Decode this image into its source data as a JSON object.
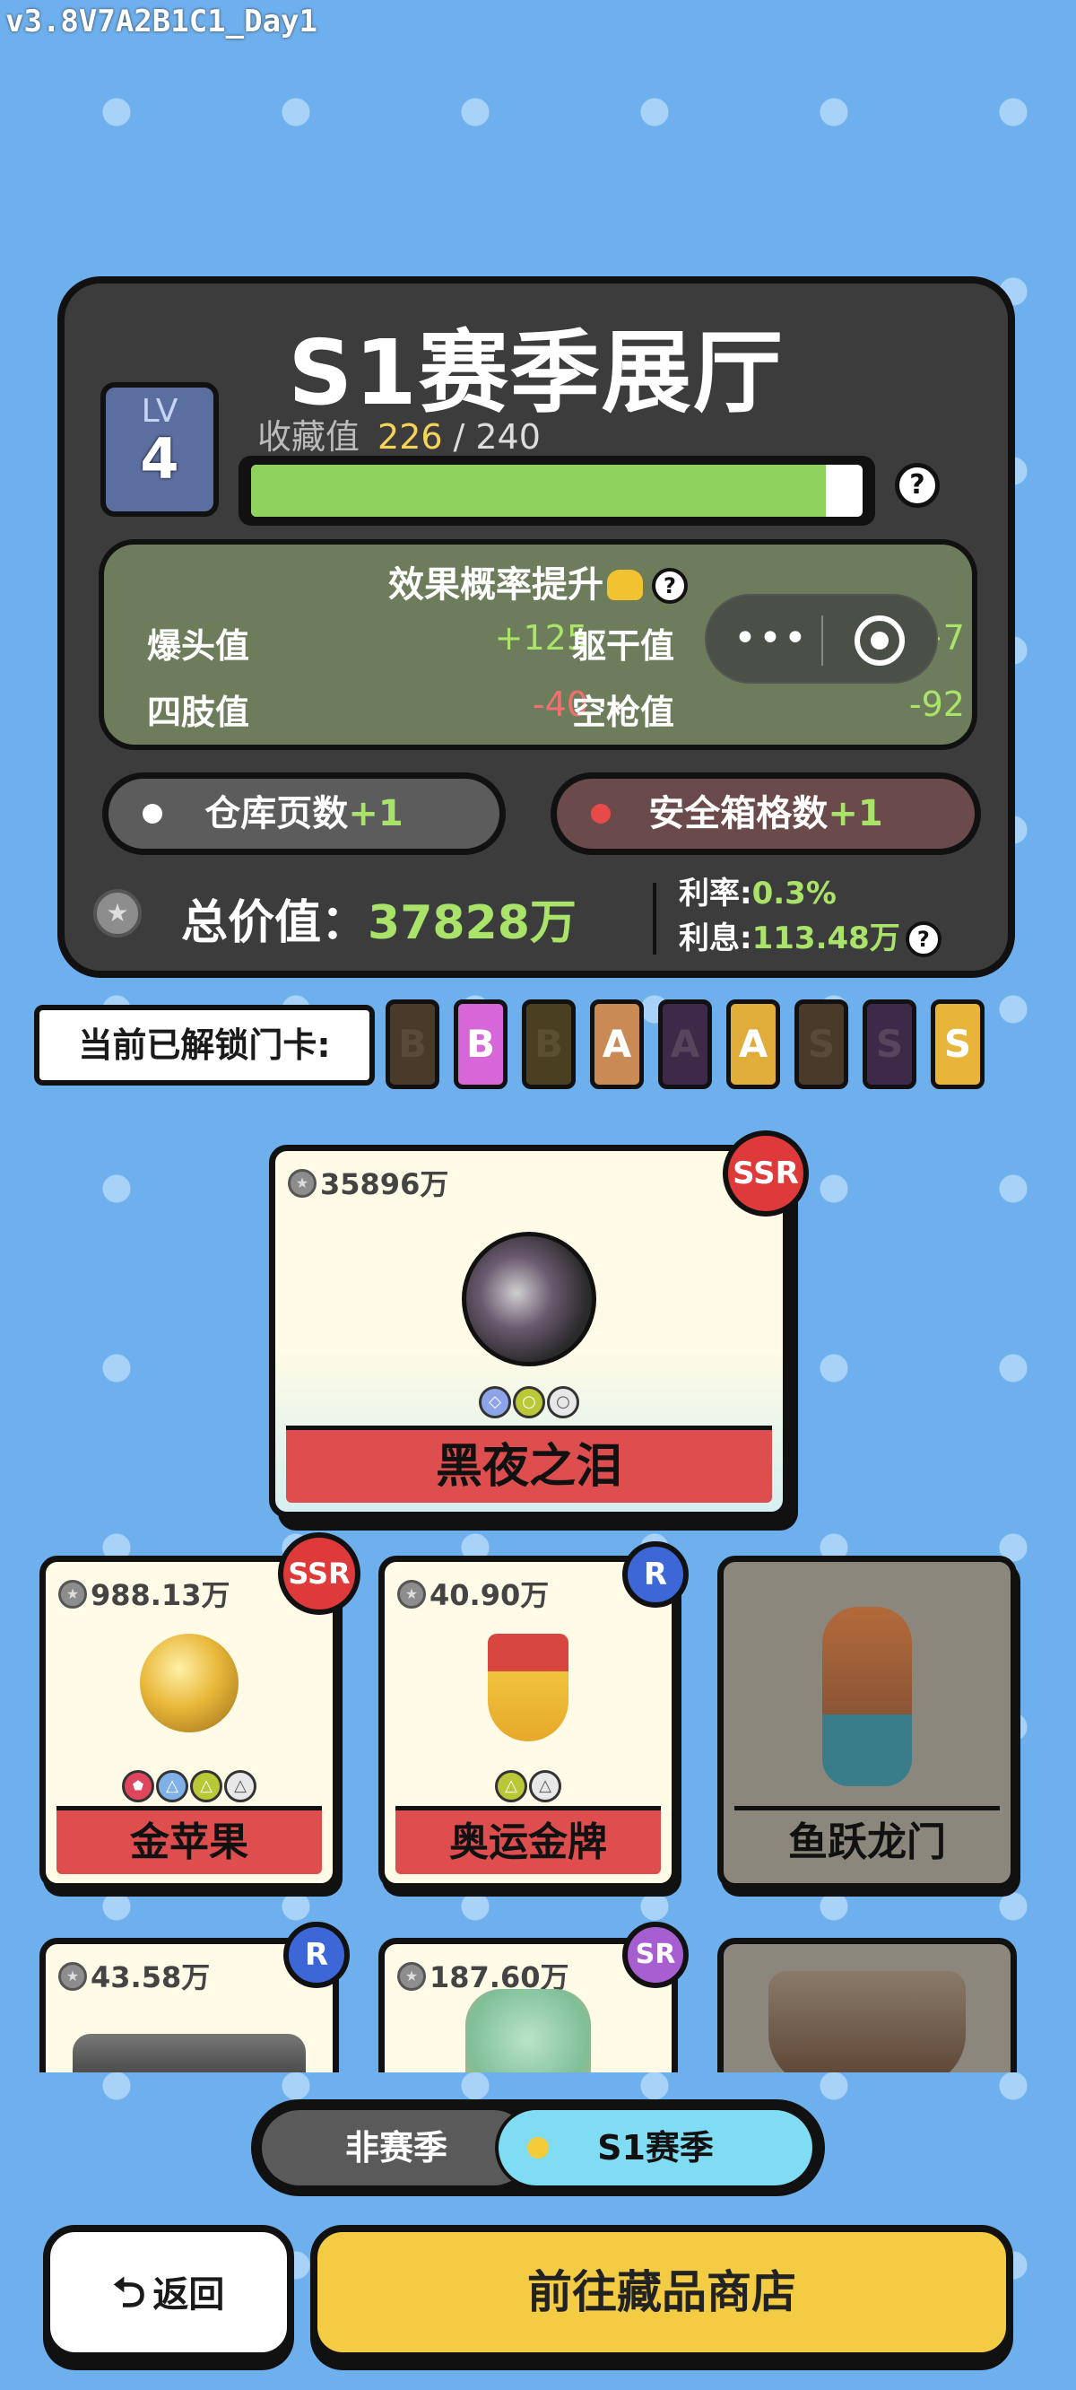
{
  "version": "v3.8V7A2B1C1_Day1",
  "hall": {
    "title": "S1赛季展厅",
    "level_label": "LV",
    "level": "4",
    "collect_label": "收藏值",
    "collect_current": "226",
    "collect_sep": "/",
    "collect_max": "240",
    "collect_fraction": 0.94,
    "help": "?"
  },
  "effects": {
    "title": "效果概率提升",
    "help": "?",
    "stats": [
      {
        "label": "爆头值",
        "value": "+125"
      },
      {
        "label": "躯干值",
        "value": "+7"
      },
      {
        "label": "四肢值",
        "value": "-40"
      },
      {
        "label": "空枪值",
        "value": "-92"
      }
    ],
    "mini_more": "•••"
  },
  "bonuses": {
    "warehouse": {
      "label": "仓库页数",
      "plus": "+1"
    },
    "safe": {
      "label": "安全箱格数",
      "plus": "+1"
    }
  },
  "total": {
    "label": "总价值：",
    "value": "37828万",
    "rate_label": "利率:",
    "rate_value": "0.3%",
    "interest_label": "利息:",
    "interest_value": "113.48万",
    "help": "?"
  },
  "unlock": {
    "label": "当前已解锁门卡:",
    "cards": [
      {
        "letter": "B",
        "bg": "#4a3a2a",
        "fg": "#5a4a3a"
      },
      {
        "letter": "B",
        "bg": "#d767d8",
        "fg": "#ffffff"
      },
      {
        "letter": "B",
        "bg": "#4a3f20",
        "fg": "#5a5030"
      },
      {
        "letter": "A",
        "bg": "#c98a55",
        "fg": "#ffffff"
      },
      {
        "letter": "A",
        "bg": "#3c2a48",
        "fg": "#55465e"
      },
      {
        "letter": "A",
        "bg": "#e0ad3a",
        "fg": "#ffffff"
      },
      {
        "letter": "S",
        "bg": "#4a3a2a",
        "fg": "#5a4a3a"
      },
      {
        "letter": "S",
        "bg": "#3c2a48",
        "fg": "#55465e"
      },
      {
        "letter": "S",
        "bg": "#e8b53a",
        "fg": "#ffffff"
      }
    ]
  },
  "items": {
    "featured": {
      "price": "35896万",
      "rarity": "SSR",
      "name": "黑夜之泪"
    },
    "row1": [
      {
        "price": "988.13万",
        "rarity": "SSR",
        "name": "金苹果"
      },
      {
        "price": "40.90万",
        "rarity": "R",
        "name": "奥运金牌"
      },
      {
        "name": "鱼跃龙门"
      }
    ],
    "row2": [
      {
        "price": "43.58万",
        "rarity": "R"
      },
      {
        "price": "187.60万",
        "rarity": "SR"
      }
    ]
  },
  "season_toggle": {
    "off_label": "非赛季",
    "on_label": "S1赛季"
  },
  "buttons": {
    "back": "返回",
    "back_icon": "⮌",
    "shop": "前往藏品商店"
  },
  "icons": [
    "coin-icon",
    "help-icon",
    "warning-icon",
    "more-icon",
    "target-icon",
    "back-arrow-icon"
  ]
}
